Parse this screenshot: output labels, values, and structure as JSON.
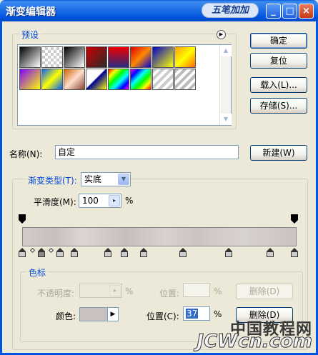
{
  "window": {
    "title": "渐变编辑器",
    "logo_text": "五笔加加"
  },
  "presets": {
    "legend": "预设"
  },
  "buttons": {
    "ok": "确定",
    "reset": "复位",
    "load": "载入(L)...",
    "save": "存储(S)...",
    "new": "新建(W)",
    "delete_opacity": "删除(D)",
    "delete_color": "删除(D)"
  },
  "name": {
    "label": "名称(N):",
    "value": "自定"
  },
  "gradient": {
    "type_label": "渐变类型(T):",
    "type_value": "实底",
    "smoothness_label": "平滑度(M):",
    "smoothness_value": "100",
    "percent": "%"
  },
  "stops": {
    "legend": "色标",
    "opacity_label": "不透明度:",
    "opacity_unit": "%",
    "opacity_position_label": "位置:",
    "opacity_position_unit": "%",
    "color_label": "颜色:",
    "position_label": "位置(C):",
    "position_value": "37",
    "position_unit": "%"
  },
  "watermark": {
    "cn": "中国教程网",
    "en": "JCWcn.com"
  },
  "colors": {
    "accent": "#0046d5",
    "titlebar": "#0055e0",
    "stop_color": "#c8c1be"
  }
}
